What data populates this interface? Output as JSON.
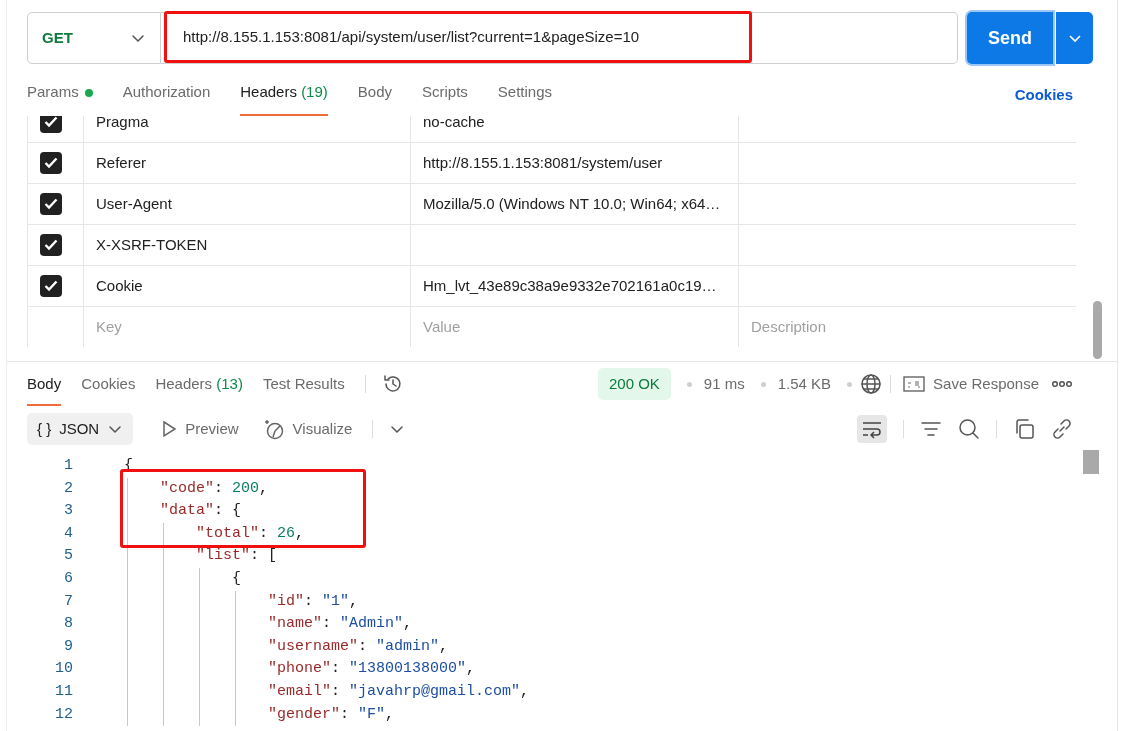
{
  "request": {
    "method": "GET",
    "url": "http://8.155.1.153:8081/api/system/user/list?current=1&pageSize=10",
    "url_highlighted": true,
    "send_label": "Send"
  },
  "request_tabs": [
    {
      "label": "Params",
      "dot": true,
      "selected": false
    },
    {
      "label": "Authorization",
      "dot": false,
      "selected": false
    },
    {
      "label": "Headers",
      "count": "(19)",
      "dot": false,
      "selected": true
    },
    {
      "label": "Body",
      "dot": false,
      "selected": false
    },
    {
      "label": "Scripts",
      "dot": false,
      "selected": false
    },
    {
      "label": "Settings",
      "dot": false,
      "selected": false
    }
  ],
  "cookies_link": "Cookies",
  "headers": [
    {
      "checked": true,
      "key": "Pragma",
      "value": "no-cache"
    },
    {
      "checked": true,
      "key": "Referer",
      "value": "http://8.155.1.153:8081/system/user"
    },
    {
      "checked": true,
      "key": "User-Agent",
      "value": "Mozilla/5.0 (Windows NT 10.0; Win64; x64…"
    },
    {
      "checked": true,
      "key": "X-XSRF-TOKEN"
    },
    {
      "checked": true,
      "key": "Cookie",
      "value": "Hm_lvt_43e89c38a9e9332e702161a0c19…"
    }
  ],
  "new_header": {
    "key_placeholder": "Key",
    "value_placeholder": "Value",
    "description_placeholder": "Description"
  },
  "response_tabs": [
    {
      "label": "Body",
      "selected": true
    },
    {
      "label": "Cookies",
      "selected": false
    },
    {
      "label": "Headers",
      "count": "(13)",
      "selected": false
    },
    {
      "label": "Test Results",
      "selected": false
    }
  ],
  "response_meta": {
    "status": "200 OK",
    "time": "91 ms",
    "size": "1.54 KB",
    "save_label": "Save Response"
  },
  "body_toolbar": {
    "format": "JSON",
    "format_glyph": "{ }",
    "preview": "Preview",
    "visualize": "Visualize",
    "wrap_on": true
  },
  "code_lines": [
    {
      "number": "1",
      "text": "{",
      "highlighted": false
    },
    {
      "number": "2",
      "text": "    \"code\": 200,",
      "highlighted": true
    },
    {
      "number": "3",
      "text": "    \"data\": {",
      "highlighted": true
    },
    {
      "number": "4",
      "text": "        \"total\": 26,",
      "highlighted": true
    },
    {
      "number": "5",
      "text": "        \"list\": [",
      "highlighted": false
    },
    {
      "number": "6",
      "text": "            {",
      "highlighted": false
    },
    {
      "number": "7",
      "text": "                \"id\": \"1\",",
      "highlighted": false
    },
    {
      "number": "8",
      "text": "                \"name\": \"Admin\",",
      "highlighted": false
    },
    {
      "number": "9",
      "text": "                \"username\": \"admin\",",
      "highlighted": false
    },
    {
      "number": "10",
      "text": "                \"phone\": \"13800138000\",",
      "highlighted": false
    },
    {
      "number": "11",
      "text": "                \"email\": \"javahrp@gmail.com\",",
      "highlighted": false
    },
    {
      "number": "12",
      "text": "                \"gender\": \"F\",",
      "highlighted": false
    }
  ]
}
